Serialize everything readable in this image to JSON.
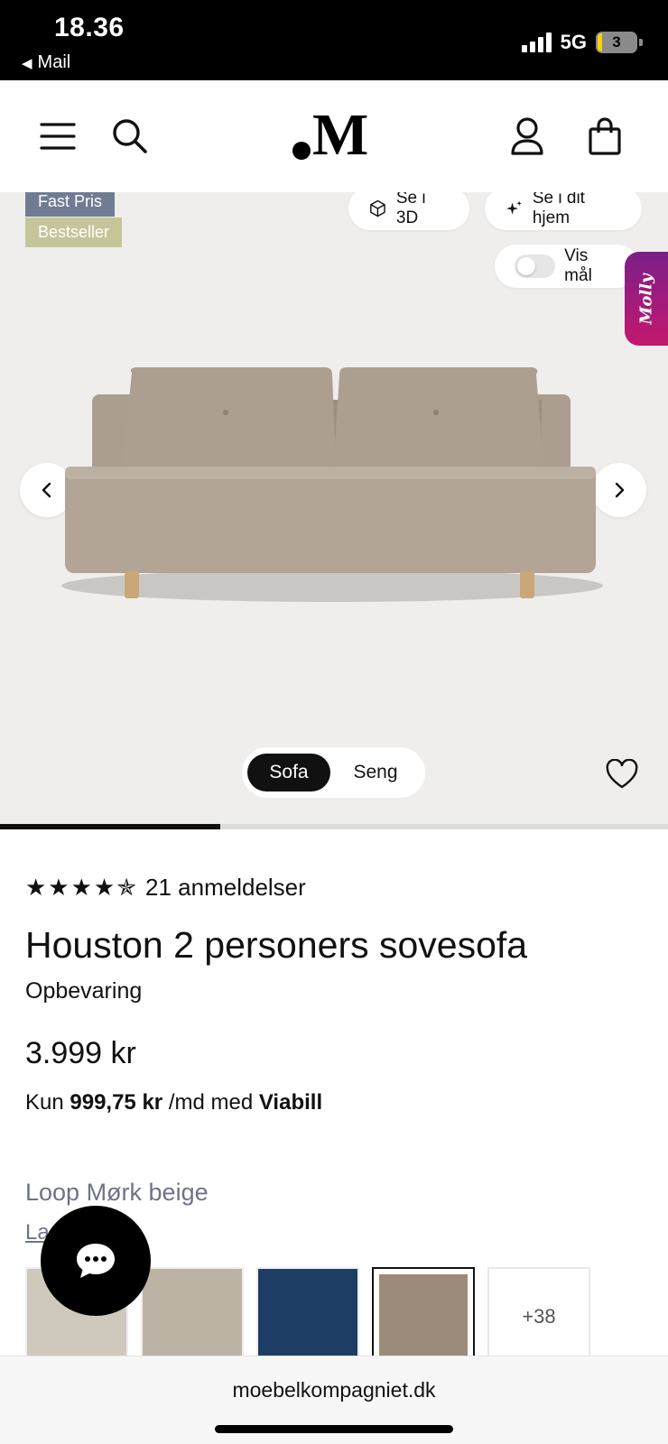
{
  "status_bar": {
    "time": "18.36",
    "back_app": "Mail",
    "network": "5G",
    "battery": "3"
  },
  "header": {
    "logo_text": "M"
  },
  "gallery": {
    "badges": [
      "Fast Pris",
      "Bestseller"
    ],
    "view_3d_label": "Se i 3D",
    "view_home_label": "Se i dit hjem",
    "show_dimensions_label": "Vis mål",
    "molly_label": "Molly",
    "image_progress": 0.33,
    "view_toggle": {
      "options": [
        "Sofa",
        "Seng"
      ],
      "selected": "Sofa"
    }
  },
  "product": {
    "rating_stars": "★★★★✯",
    "rating": 4.5,
    "reviews_label": "21 anmeldelser",
    "title": "Houston 2 personers sovesofa",
    "subtitle": "Opbevaring",
    "price": "3.999 kr",
    "finance": {
      "prefix": "Kun",
      "amount": "999,75 kr",
      "middle": "/md med",
      "provider": "Viabill"
    },
    "color_name": "Loop Mørk beige",
    "stock_link": "Lagerstoffet",
    "swatches": [
      {
        "name": "light-beige",
        "color": "#cfc8bd"
      },
      {
        "name": "sand",
        "color": "#bdb3a5"
      },
      {
        "name": "navy-blue",
        "color": "#1e3d64"
      },
      {
        "name": "dark-beige",
        "color": "#9c8b7a",
        "selected": true
      }
    ],
    "more_swatches_label": "+38"
  },
  "browser": {
    "url": "moebelkompagniet.dk"
  },
  "colors": {
    "badge_fast": "#6f7c92",
    "badge_bestseller": "#c6c59a",
    "gallery_bg": "#efeeec",
    "molly_gradient": [
      "#7b1f8a",
      "#c4186e"
    ]
  }
}
